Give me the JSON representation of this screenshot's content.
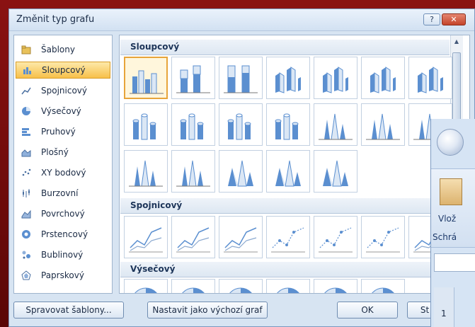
{
  "dialog": {
    "title": "Změnit typ grafu",
    "help_label": "?",
    "close_label": "✕"
  },
  "categories": [
    {
      "label": "Šablony",
      "icon": "folder-icon"
    },
    {
      "label": "Sloupcový",
      "icon": "column-chart-icon",
      "selected": true
    },
    {
      "label": "Spojnicový",
      "icon": "line-chart-icon"
    },
    {
      "label": "Výsečový",
      "icon": "pie-chart-icon"
    },
    {
      "label": "Pruhový",
      "icon": "bar-chart-icon"
    },
    {
      "label": "Plošný",
      "icon": "area-chart-icon"
    },
    {
      "label": "XY bodový",
      "icon": "scatter-chart-icon"
    },
    {
      "label": "Burzovní",
      "icon": "stock-chart-icon"
    },
    {
      "label": "Povrchový",
      "icon": "surface-chart-icon"
    },
    {
      "label": "Prstencový",
      "icon": "doughnut-chart-icon"
    },
    {
      "label": "Bublinový",
      "icon": "bubble-chart-icon"
    },
    {
      "label": "Paprskový",
      "icon": "radar-chart-icon"
    }
  ],
  "sections": {
    "column": "Sloupcový",
    "line": "Spojnicový",
    "pie": "Výsečový"
  },
  "buttons": {
    "manage_templates": "Spravovat šablony...",
    "set_default": "Nastavit jako výchozí graf",
    "ok": "OK",
    "cancel_partial": "St"
  },
  "background_app": {
    "paste_label": "Vlož",
    "clipboard_label": "Schrá",
    "row_number": "1"
  },
  "colors": {
    "accent_selected": "#f7c04a",
    "chart_blue": "#5b8fd0",
    "chart_light": "#dbe7f5",
    "frame_red": "#6e0a0a"
  }
}
